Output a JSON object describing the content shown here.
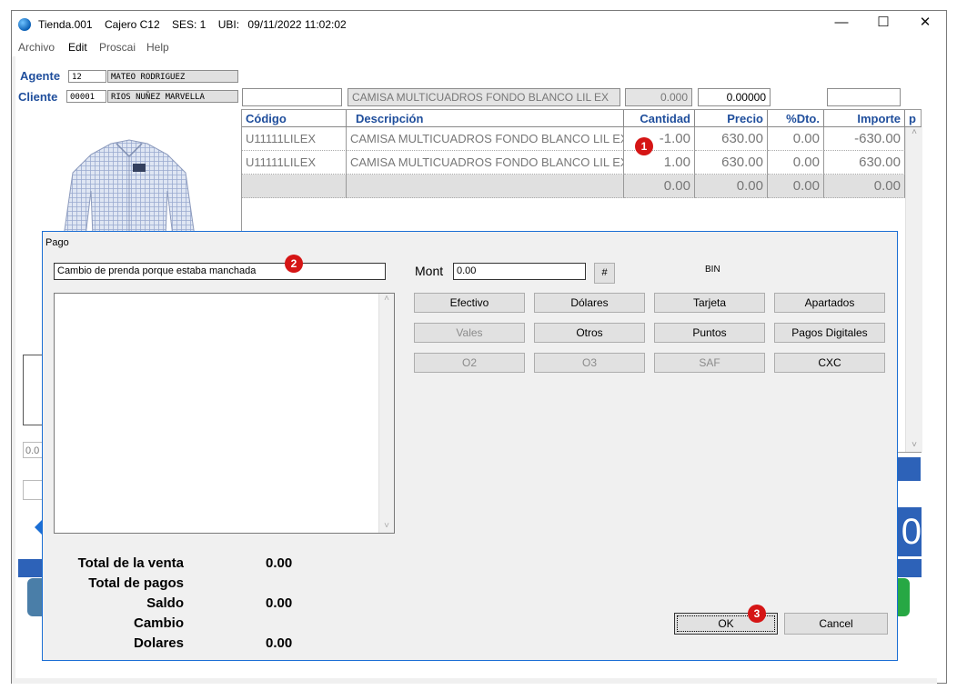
{
  "window": {
    "app": "Tienda.001",
    "cashier": "Cajero C12",
    "session": "SES: 1",
    "location": "UBI:",
    "datetime": "09/11/2022 11:02:02",
    "minimize": "—",
    "maximize": "☐",
    "close": "✕"
  },
  "menu": [
    "Archivo",
    "Edit",
    "Proscai",
    "Help"
  ],
  "agent": {
    "label": "Agente",
    "code": "12",
    "name": "MATEO RODRIGUEZ"
  },
  "client": {
    "label": "Cliente",
    "code": "00001",
    "name": "RIOS NUÑEZ MARVELLA"
  },
  "product_line": {
    "code": "",
    "description": "CAMISA MULTICUADROS FONDO BLANCO LIL EX",
    "quantity": "0.000",
    "price": "0.00000",
    "extra": ""
  },
  "grid": {
    "headers": [
      "Código",
      "Descripción",
      "Cantidad",
      "Precio",
      "%Dto.",
      "Importe",
      "p"
    ],
    "rows": [
      {
        "code": "U11111LILEX",
        "description": "CAMISA MULTICUADROS FONDO BLANCO LIL EX",
        "qty": "-1.00",
        "price": "630.00",
        "disc": "0.00",
        "amount": "-630.00"
      },
      {
        "code": "U11111LILEX",
        "description": "CAMISA MULTICUADROS FONDO BLANCO LIL EX",
        "qty": "1.00",
        "price": "630.00",
        "disc": "0.00",
        "amount": "630.00"
      }
    ],
    "totals": {
      "qty": "0.00",
      "price": "0.00",
      "disc": "0.00",
      "amount": "0.00"
    }
  },
  "bg_partial": {
    "left_value": "0.0",
    "big_digit": "0"
  },
  "dialog": {
    "title": "Pago",
    "comment": "Cambio de prenda porque estaba manchada",
    "mont_label": "Mont",
    "mont_value": "0.00",
    "hash_btn": "#",
    "bin_label": "BIN",
    "buttons": {
      "efectivo": "Efectivo",
      "dolares": "Dólares",
      "tarjeta": "Tarjeta",
      "apartados": "Apartados",
      "vales": "Vales",
      "otros": "Otros",
      "puntos": "Puntos",
      "pagos_digitales": "Pagos Digitales",
      "o2": "O2",
      "o3": "O3",
      "saf": "SAF",
      "cxc": "CXC"
    },
    "totals": [
      {
        "label": "Total de la venta",
        "value": "0.00"
      },
      {
        "label": "Total de pagos",
        "value": ""
      },
      {
        "label": "Saldo",
        "value": "0.00"
      },
      {
        "label": "Cambio",
        "value": ""
      },
      {
        "label": "Dolares",
        "value": "0.00"
      }
    ],
    "ok": "OK",
    "cancel": "Cancel"
  },
  "badges": [
    "1",
    "2",
    "3"
  ],
  "colors": {
    "label_blue": "#1f4e9c",
    "badge_red": "#d51515",
    "dialog_border": "#1b6ed4"
  }
}
